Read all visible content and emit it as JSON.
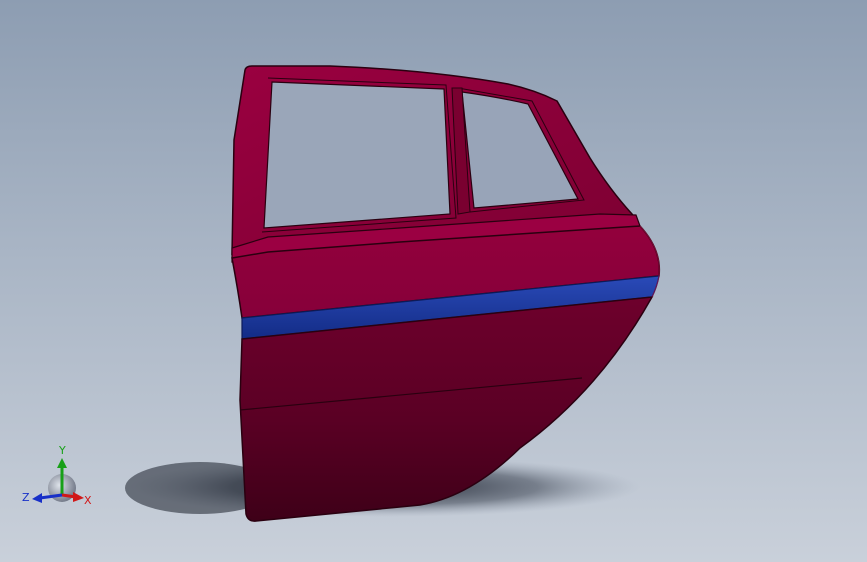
{
  "viewport": {
    "background_top": "#8d9db2",
    "background_bottom": "#c9d0da"
  },
  "model": {
    "part": "car-rear-door",
    "body_color": "#8b0038",
    "stripe_color": "#1f3fa6",
    "outline_color": "#2a0010"
  },
  "triad": {
    "x_label": "X",
    "y_label": "Y",
    "z_label": "Z",
    "x_color": "#d01818",
    "y_color": "#18a018",
    "z_color": "#1830c8"
  }
}
